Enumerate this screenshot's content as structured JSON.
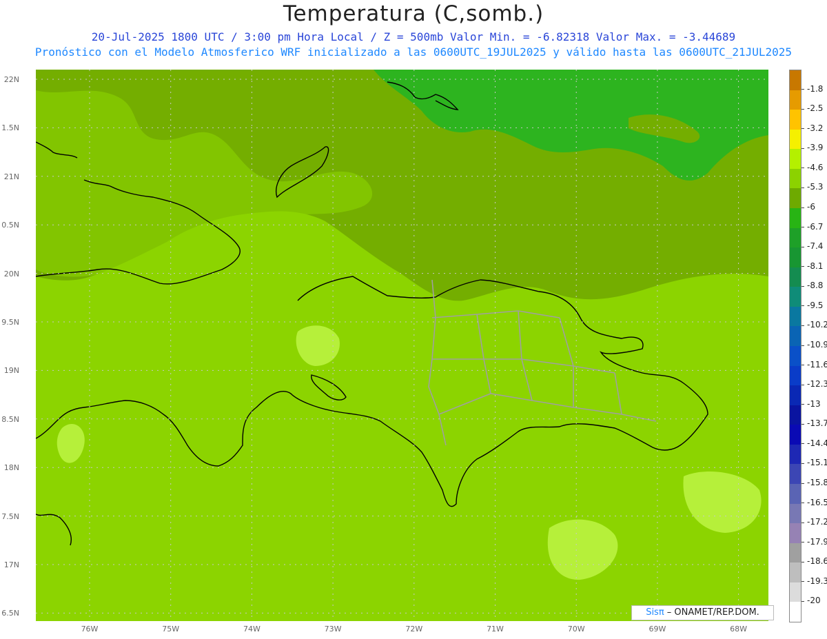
{
  "header": {
    "title": "Temperatura (C,somb.)",
    "line1": "20-Jul-2025   1800 UTC / 3:00 pm Hora Local / Z = 500mb  Valor Min. = -6.82318  Valor Max. = -3.44689",
    "line2": "Pronóstico con el Modelo Atmosferico WRF inicializado a las 0600UTC_19JUL2025 y válido hasta las  0600UTC_21JUL2025"
  },
  "axes": {
    "lat_labels": [
      "22N",
      "1.5N",
      "21N",
      "0.5N",
      "20N",
      "9.5N",
      "19N",
      "8.5N",
      "18N",
      "7.5N",
      "17N",
      "6.5N"
    ],
    "lon_labels": [
      "76W",
      "75W",
      "74W",
      "73W",
      "72W",
      "71W",
      "70W",
      "69W",
      "68W"
    ]
  },
  "colorbar": {
    "labels": [
      "-1.8",
      "-2.5",
      "-3.2",
      "-3.9",
      "-4.6",
      "-5.3",
      "-6",
      "-6.7",
      "-7.4",
      "-8.1",
      "-8.8",
      "-9.5",
      "-10.2",
      "-10.9",
      "-11.6",
      "-12.3",
      "-13",
      "-13.7",
      "-14.4",
      "-15.1",
      "-15.8",
      "-16.5",
      "-17.2",
      "-17.9",
      "-18.6",
      "-19.3",
      "-20"
    ],
    "colors": [
      "#c87800",
      "#e69b00",
      "#ffc300",
      "#f5f000",
      "#b4f000",
      "#8cd200",
      "#6eaa00",
      "#28b414",
      "#1ea028",
      "#189632",
      "#148c50",
      "#0f8c78",
      "#0a78a0",
      "#0a64b4",
      "#0a50c8",
      "#0a3cc8",
      "#0a28b4",
      "#0a14a0",
      "#0a0ab4",
      "#1e28b4",
      "#3c46b4",
      "#5a64b4",
      "#7878b4",
      "#9682b4",
      "#a0a0a0",
      "#bebebe",
      "#dcdcdc",
      "#ffffff"
    ]
  },
  "map": {
    "colors": {
      "light": "#b6f03a",
      "main": "#8cd400",
      "mid": "#74ae00",
      "dark": "#2db41f",
      "coast": "#000000",
      "border": "#a0a0a0"
    }
  },
  "credit": {
    "sis": "Sisπ",
    "rest": " – ONAMET/REP.DOM."
  }
}
